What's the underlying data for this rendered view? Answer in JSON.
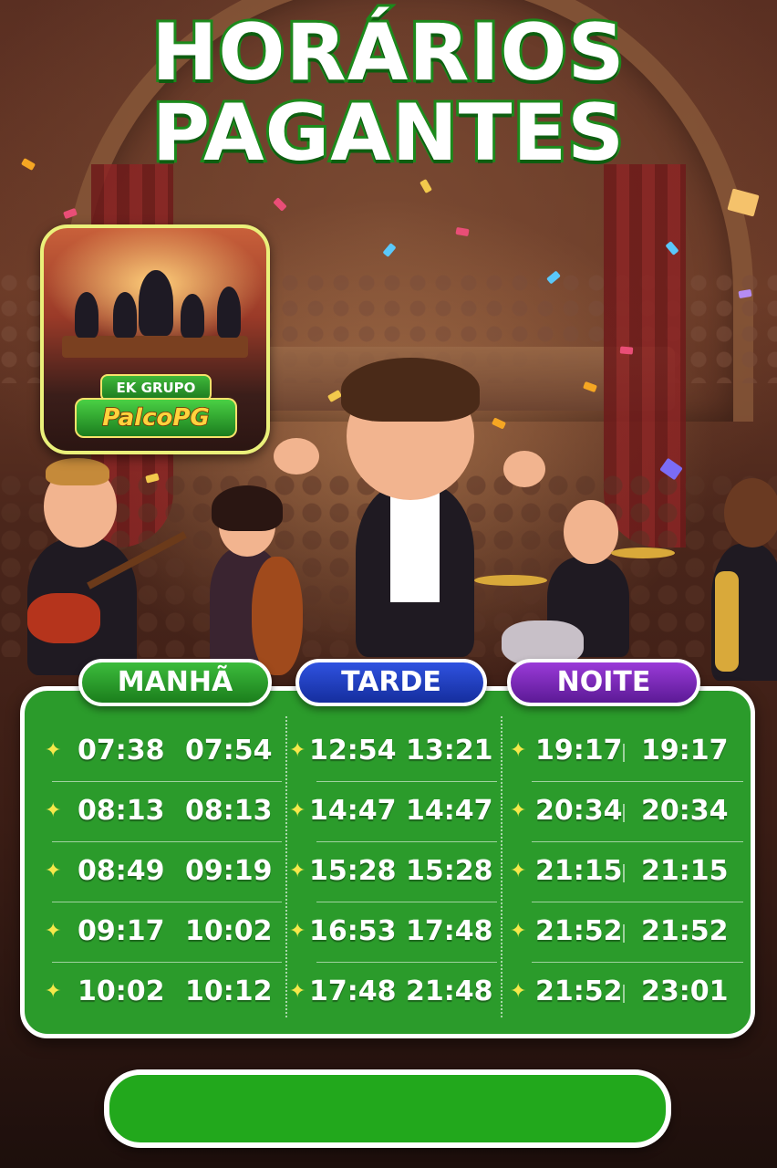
{
  "title": {
    "line1": "HORÁRIOS",
    "line2": "PAGANTES"
  },
  "logo": {
    "top_label": "EK GRUPO",
    "brand": "PalcoPG"
  },
  "schedule": [
    {
      "period": "MANHÃ",
      "color": "#2a9a2a",
      "rows": [
        [
          "07:38",
          "07:54"
        ],
        [
          "08:13",
          "08:13"
        ],
        [
          "08:49",
          "09:19"
        ],
        [
          "09:17",
          "10:02"
        ],
        [
          "10:02",
          "10:12"
        ]
      ]
    },
    {
      "period": "TARDE",
      "color": "#1f3fc0",
      "rows": [
        [
          "12:54",
          "13:21"
        ],
        [
          "14:47",
          "14:47"
        ],
        [
          "15:28",
          "15:28"
        ],
        [
          "16:53",
          "17:48"
        ],
        [
          "17:48",
          "21:48"
        ]
      ]
    },
    {
      "period": "NOITE",
      "color": "#7a2ab8",
      "rows": [
        [
          "19:17",
          "19:17"
        ],
        [
          "20:34",
          "20:34"
        ],
        [
          "21:15",
          "21:15"
        ],
        [
          "21:52",
          "21:52"
        ],
        [
          "21:52",
          "23:01"
        ]
      ]
    }
  ],
  "icons": {
    "bullet": "sparkle-icon"
  },
  "colors": {
    "panel": "#2b9b2b",
    "title_stroke": "#1c8a1c",
    "cta": "#22a81c"
  }
}
